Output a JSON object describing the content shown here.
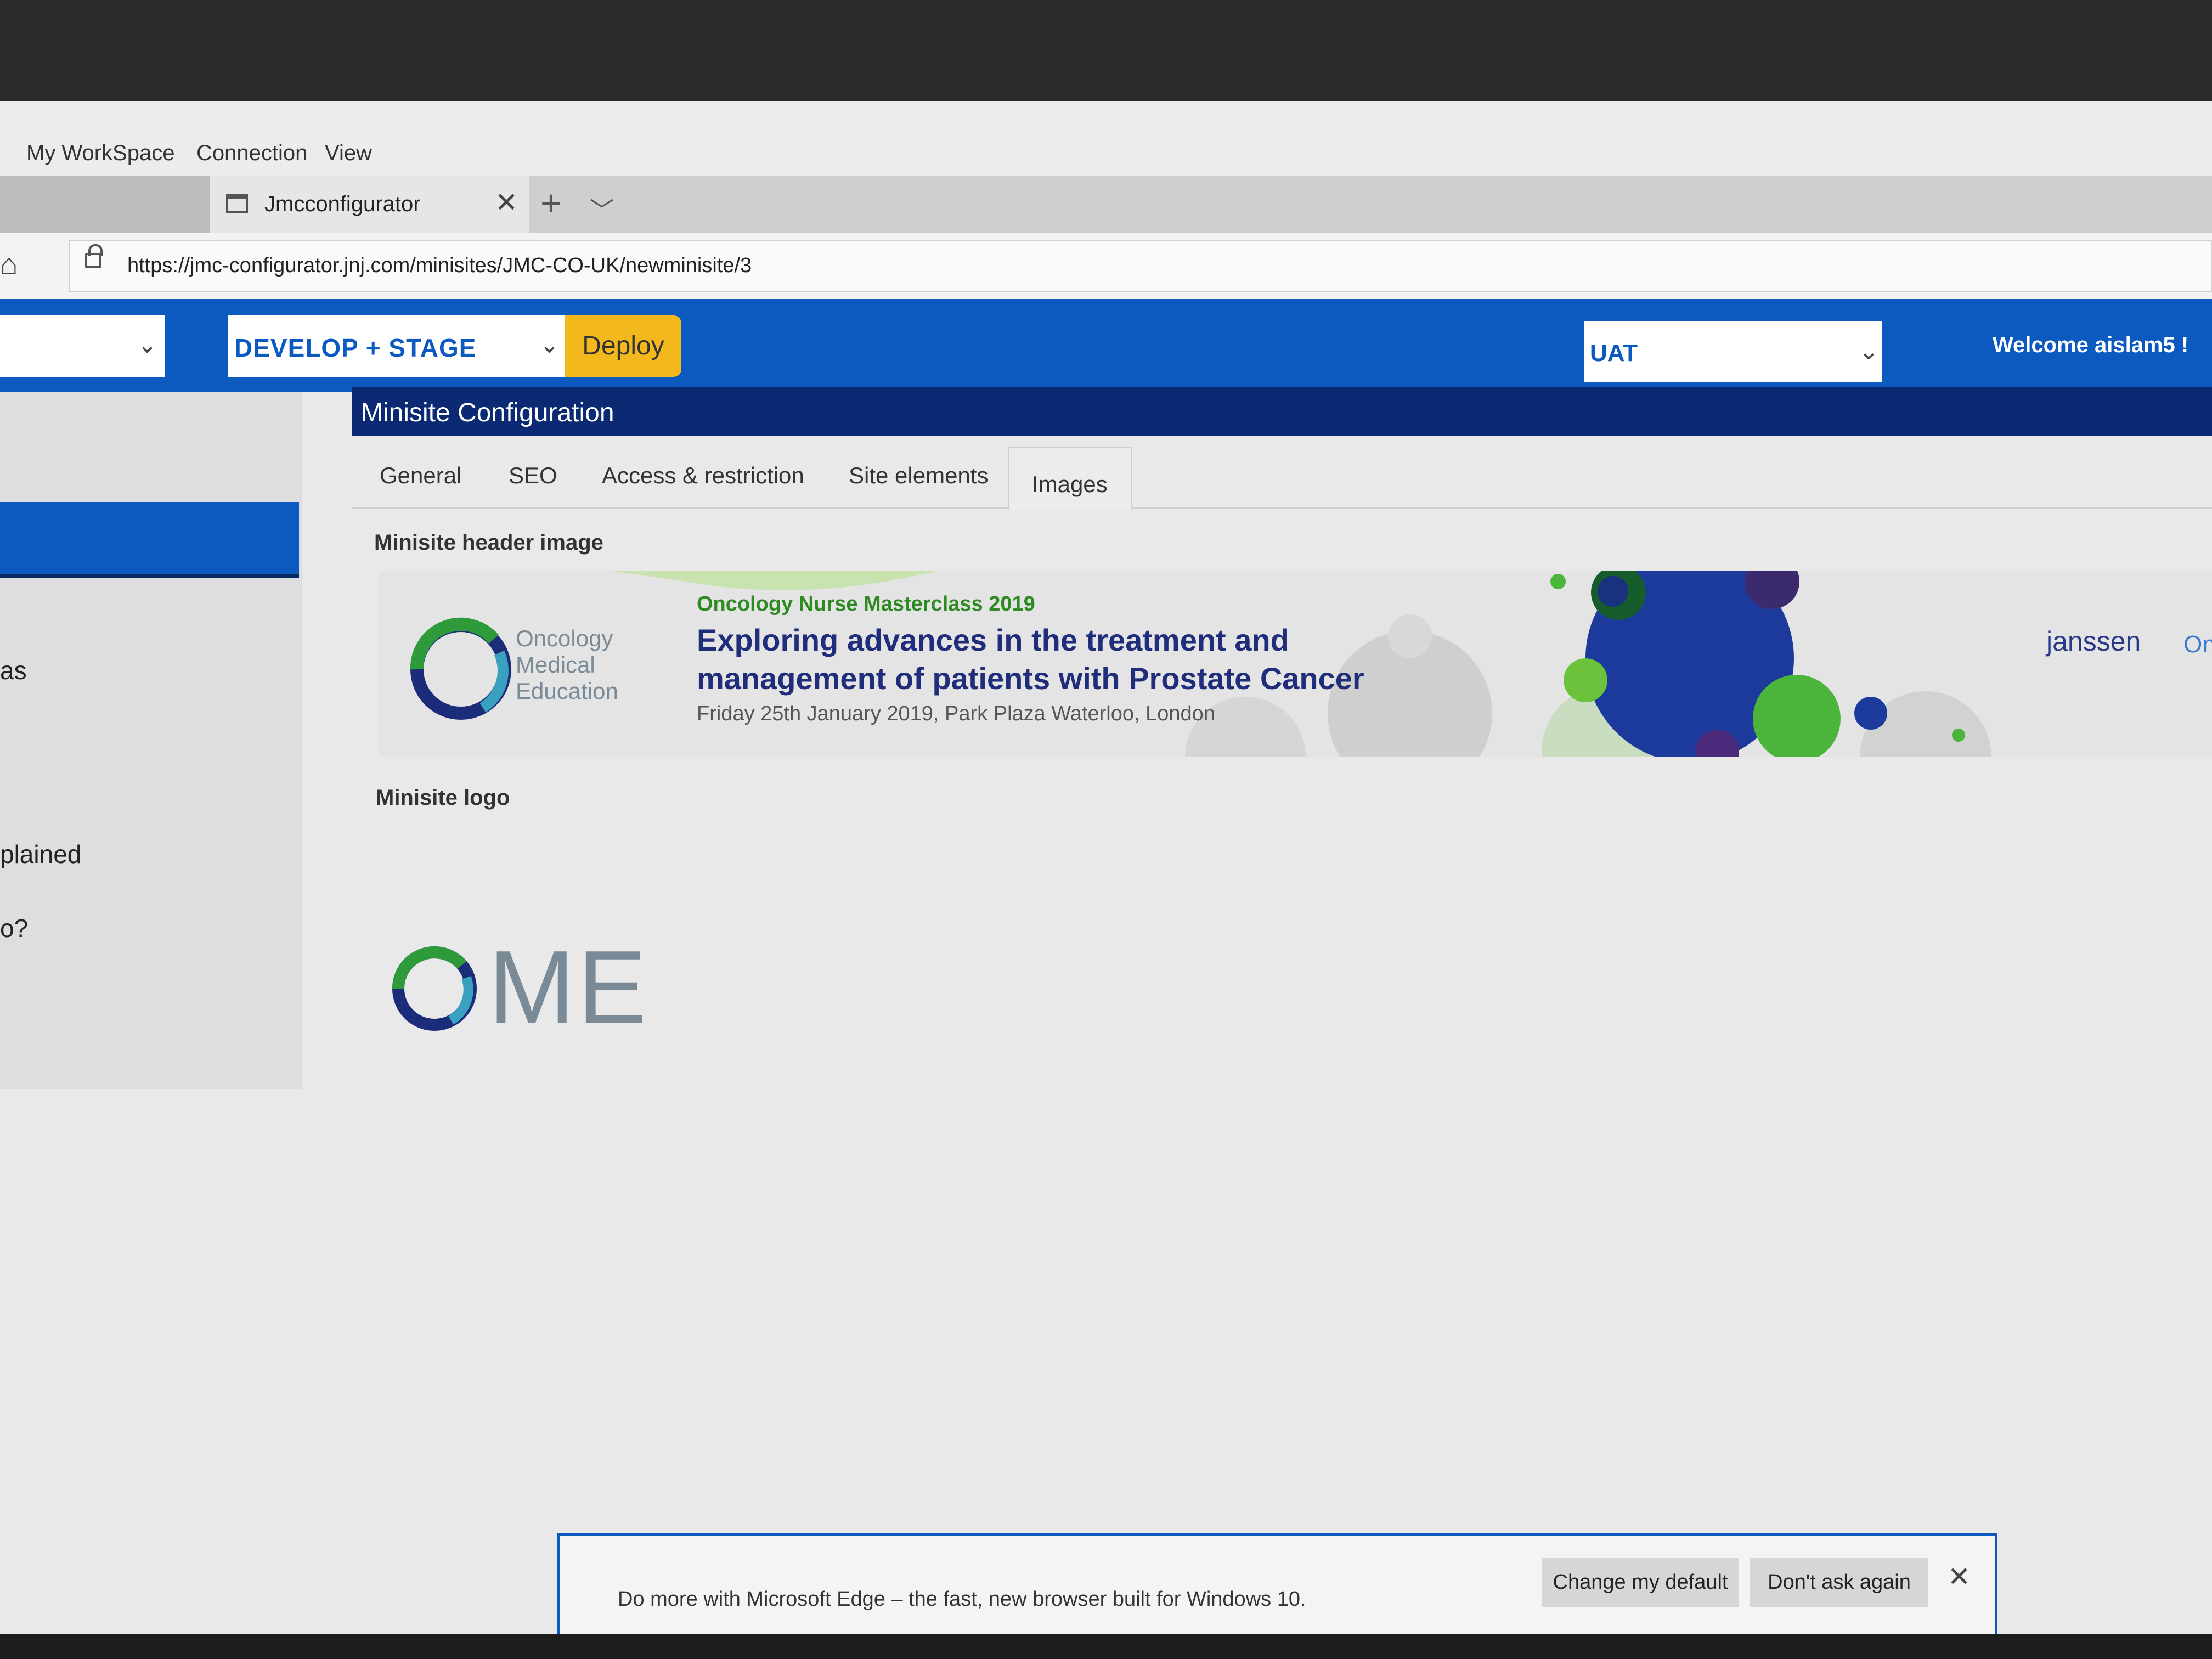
{
  "app_menu": [
    "My WorkSpace",
    "Connection",
    "View"
  ],
  "browser": {
    "tab_title": "Jmcconfigurator",
    "url": "https://jmc-configurator.jnj.com/minisites/JMC-CO-UK/newminisite/3"
  },
  "header": {
    "stage": "DEVELOP + STAGE",
    "deploy_label": "Deploy",
    "environment": "UAT",
    "welcome": "Welcome aislam5 !"
  },
  "sidebar": {
    "fragments": [
      "as",
      "plained",
      "o?"
    ]
  },
  "panel": {
    "title": "Minisite Configuration",
    "tabs": [
      {
        "label": "General"
      },
      {
        "label": "SEO"
      },
      {
        "label": "Access & restriction"
      },
      {
        "label": "Site elements"
      },
      {
        "label": "Images",
        "active": true
      }
    ],
    "header_image_label": "Minisite header image",
    "logo_label": "Minisite logo"
  },
  "banner": {
    "org_lines": [
      "Oncology",
      "Medical",
      "Education"
    ],
    "overline": "Oncology Nurse Masterclass 2019",
    "title": "Exploring advances in the treatment and management of patients with Prostate Cancer",
    "subtitle": "Friday 25th January 2019, Park Plaza Waterloo, London",
    "sponsor": "janssen",
    "sponsor_suffix": "On"
  },
  "logo": {
    "text": "ME"
  },
  "notification": {
    "text": "Do more with Microsoft Edge – the fast, new browser built for Windows 10.",
    "change_default": "Change my default",
    "dont_ask": "Don't ask again"
  },
  "colors": {
    "primary_blue": "#0c5ac0",
    "navy": "#0b2a73",
    "deploy_yellow": "#f2b81c",
    "banner_green": "#2e8a22",
    "banner_title": "#1f2d7a"
  }
}
